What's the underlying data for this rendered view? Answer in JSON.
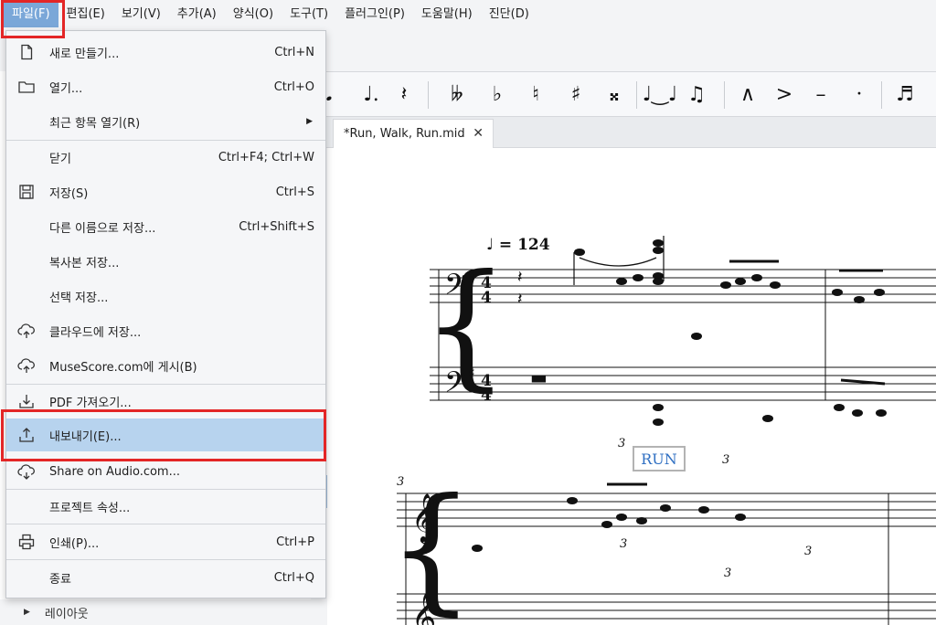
{
  "menubar": {
    "items": [
      "파일(F)",
      "편집(E)",
      "보기(V)",
      "추가(A)",
      "양식(O)",
      "도구(T)",
      "플러그인(P)",
      "도움말(H)",
      "진단(D)"
    ]
  },
  "file_menu": {
    "new": {
      "label": "새로 만들기...",
      "shortcut": "Ctrl+N"
    },
    "open": {
      "label": "열기...",
      "shortcut": "Ctrl+O"
    },
    "recent": {
      "label": "최근 항목 열기(R)"
    },
    "close": {
      "label": "닫기",
      "shortcut": "Ctrl+F4; Ctrl+W"
    },
    "save": {
      "label": "저장(S)",
      "shortcut": "Ctrl+S"
    },
    "save_as": {
      "label": "다른 이름으로 저장...",
      "shortcut": "Ctrl+Shift+S"
    },
    "save_copy": {
      "label": "복사본 저장..."
    },
    "save_selection": {
      "label": "선택 저장..."
    },
    "save_cloud": {
      "label": "클라우드에 저장..."
    },
    "publish": {
      "label": "MuseScore.com에 게시(B)"
    },
    "import_pdf": {
      "label": "PDF 가져오기..."
    },
    "export": {
      "label": "내보내기(E)..."
    },
    "share_audio": {
      "label": "Share on Audio.com..."
    },
    "project_props": {
      "label": "프로젝트 속성..."
    },
    "print": {
      "label": "인쇄(P)...",
      "shortcut": "Ctrl+P"
    },
    "quit": {
      "label": "종료",
      "shortcut": "Ctrl+Q"
    }
  },
  "document_tab": {
    "title": "*Run, Walk, Run.mid"
  },
  "score": {
    "tempo_text": "♩ = 124",
    "rehearsal": "RUN",
    "tuplet_number": "3"
  },
  "side_panel": {
    "layout_label": "레이아웃"
  },
  "colors": {
    "highlight": "#b7d3ee",
    "annotation_red": "#e32626",
    "active_menu": "#7aa7d8"
  }
}
